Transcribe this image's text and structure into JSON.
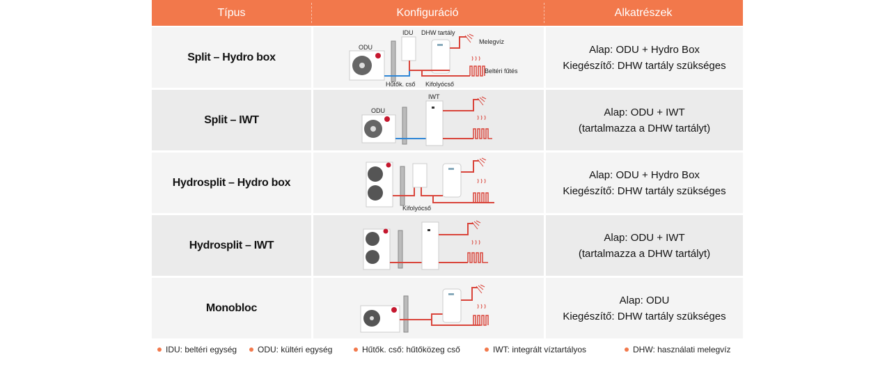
{
  "header": {
    "col_type": "Típus",
    "col_config": "Konfiguráció",
    "col_components": "Alkatrészek"
  },
  "colors": {
    "accent": "#f2784b",
    "pipe_hot": "#d9443a",
    "pipe_refrigerant": "#2e86d6",
    "row_light": "#f4f4f4",
    "row_dark": "#ebebeb"
  },
  "rows": [
    {
      "type": "Split – Hydro box",
      "diagram_labels": {
        "odu": "ODU",
        "idu": "IDU",
        "tank": "DHW tartály",
        "hot_water": "Melegvíz",
        "heating": "Beltéri fűtés",
        "ref_pipe": "Hűtők. cső",
        "outlet": "Kifolyócső"
      },
      "components": [
        "Alap: ODU + Hydro Box",
        "Kiegészítő: DHW tartály szükséges"
      ]
    },
    {
      "type": "Split – IWT",
      "diagram_labels": {
        "odu": "ODU",
        "iwt": "IWT"
      },
      "components": [
        "Alap: ODU + IWT",
        "(tartalmazza a DHW tartályt)"
      ]
    },
    {
      "type": "Hydrosplit – Hydro box",
      "diagram_labels": {
        "outlet": "Kifolyócső"
      },
      "components": [
        "Alap: ODU + Hydro Box",
        "Kiegészítő: DHW tartály szükséges"
      ]
    },
    {
      "type": "Hydrosplit – IWT",
      "diagram_labels": {},
      "components": [
        "Alap: ODU + IWT",
        "(tartalmazza a DHW tartályt)"
      ]
    },
    {
      "type": "Monobloc",
      "diagram_labels": {},
      "components": [
        "Alap: ODU",
        "Kiegészítő: DHW tartály szükséges"
      ]
    }
  ],
  "legend": [
    "IDU: beltéri egység",
    "ODU: kültéri egység",
    "Hűtők. cső: hűtőközeg cső",
    "IWT: integrált víztartályos",
    "DHW: használati melegvíz"
  ]
}
